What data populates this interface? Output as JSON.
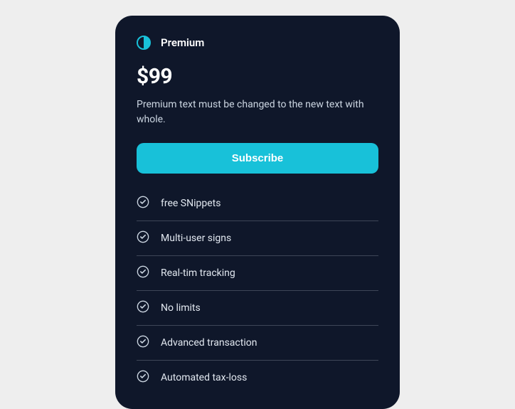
{
  "plan": {
    "name": "Premium",
    "price": "$99",
    "description": "Premium text must be changed to the new text with whole.",
    "cta": "Subscribe"
  },
  "features": [
    "free SNippets",
    "Multi-user signs",
    "Real-tim tracking",
    "No limits",
    "Advanced transaction",
    "Automated tax-loss"
  ],
  "colors": {
    "accent": "#18c1d9",
    "card_bg": "#0f172a"
  }
}
